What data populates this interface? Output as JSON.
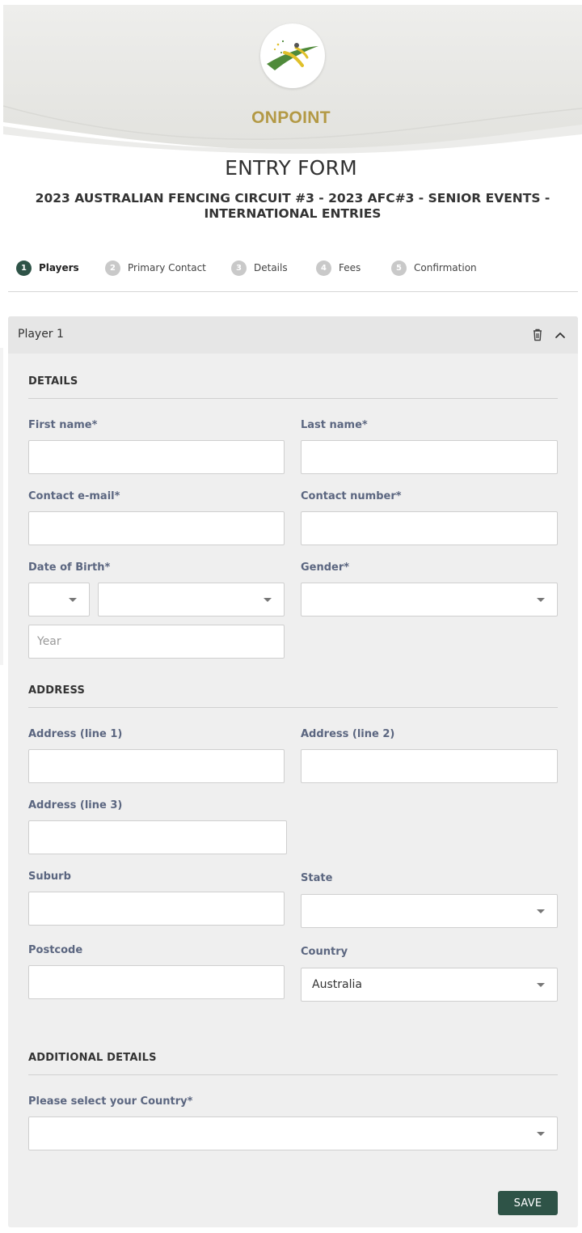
{
  "brand": {
    "name": "ONPOINT",
    "logo_icon": "onpoint-logo-icon"
  },
  "form": {
    "title": "ENTRY FORM",
    "event_title": "2023 AUSTRALIAN FENCING CIRCUIT #3 - 2023 AFC#3 - SENIOR EVENTS - INTERNATIONAL ENTRIES"
  },
  "steps": [
    {
      "number": "1",
      "label": "Players",
      "active": true
    },
    {
      "number": "2",
      "label": "Primary Contact",
      "active": false
    },
    {
      "number": "3",
      "label": "Details",
      "active": false
    },
    {
      "number": "4",
      "label": "Fees",
      "active": false
    },
    {
      "number": "5",
      "label": "Confirmation",
      "active": false
    }
  ],
  "player": {
    "title": "Player 1",
    "icons": {
      "delete": "trash-icon",
      "collapse": "chevron-up-icon"
    }
  },
  "details": {
    "heading": "DETAILS",
    "first_name": {
      "label": "First name*",
      "value": ""
    },
    "last_name": {
      "label": "Last name*",
      "value": ""
    },
    "email": {
      "label": "Contact e-mail*",
      "value": ""
    },
    "phone": {
      "label": "Contact number*",
      "value": ""
    },
    "dob": {
      "label": "Date of Birth*",
      "day": "",
      "month": "",
      "year_placeholder": "Year"
    },
    "gender": {
      "label": "Gender*",
      "value": ""
    }
  },
  "address": {
    "heading": "ADDRESS",
    "line1": {
      "label": "Address (line 1)",
      "value": ""
    },
    "line2": {
      "label": "Address (line 2)",
      "value": ""
    },
    "line3": {
      "label": "Address (line 3)",
      "value": ""
    },
    "suburb": {
      "label": "Suburb",
      "value": ""
    },
    "state": {
      "label": "State",
      "value": ""
    },
    "postcode": {
      "label": "Postcode",
      "value": ""
    },
    "country": {
      "label": "Country",
      "value": "Australia"
    }
  },
  "additional": {
    "heading": "ADDITIONAL DETAILS",
    "country_select": {
      "label": "Please select your Country*",
      "value": ""
    }
  },
  "actions": {
    "save_label": "SAVE"
  },
  "colors": {
    "brand_gold": "#b39945",
    "accent_green": "#2e5347",
    "label_slate": "#5b6680"
  }
}
